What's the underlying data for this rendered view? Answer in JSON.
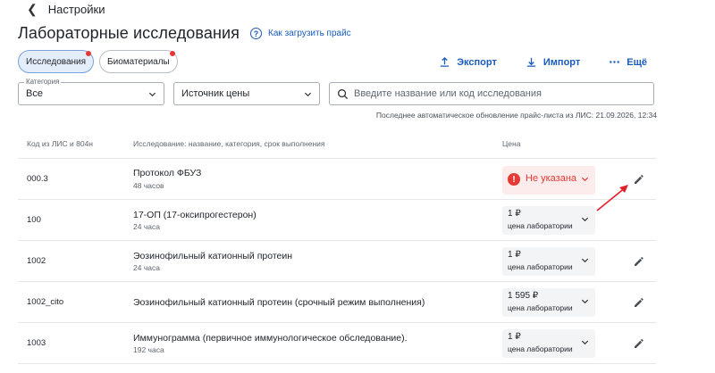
{
  "topbar": {
    "back_icon": "chevron-left-icon",
    "title": "Настройки"
  },
  "header": {
    "title": "Лабораторные исследования",
    "help_label": "Как загрузить прайс",
    "help_icon": "question-circle-icon"
  },
  "tabs": [
    {
      "label": "Исследования",
      "active": true,
      "has_dot": true
    },
    {
      "label": "Биоматериалы",
      "active": false,
      "has_dot": true
    }
  ],
  "actions": [
    {
      "label": "Экспорт",
      "icon": "upload-icon"
    },
    {
      "label": "Импорт",
      "icon": "download-icon"
    },
    {
      "label": "Ещё",
      "icon": "more-dots-icon"
    }
  ],
  "filters": {
    "category_label": "Категория",
    "category_value": "Все",
    "price_source_placeholder": "Источник цены",
    "search_placeholder": "Введите название или код исследования"
  },
  "last_update": "Последнее автоматическое обновление прайс-листа из ЛИС: 21.09.2026, 12:34",
  "table": {
    "columns": [
      "Код из ЛИС и 804н",
      "Исследование: название, категория, срок выполнения",
      "Цена"
    ],
    "rows": [
      {
        "code": "000.3",
        "name": "Протокол ФБУЗ",
        "duration": "48 часов",
        "price": "Не указана",
        "price_label": "",
        "warning": true
      },
      {
        "code": "100",
        "name": "17-ОП (17-оксипрогестерон)",
        "duration": "24 часа",
        "price": "1 ₽",
        "price_label": "цена лаборатории",
        "warning": false
      },
      {
        "code": "1002",
        "name": "Эозинофильный катионный протеин",
        "duration": "24 часа",
        "price": "1 ₽",
        "price_label": "цена лаборатории",
        "warning": false
      },
      {
        "code": "1002_cito",
        "name": "Эозинофильный катионный протеин (срочный режим выполнения)",
        "duration": "",
        "price": "1 595 ₽",
        "price_label": "цена лаборатории",
        "warning": false
      },
      {
        "code": "1003",
        "name": "Иммунограмма (первичное иммунологическое обследование).",
        "duration": "192 часа",
        "price": "1 ₽",
        "price_label": "цена лаборатории",
        "warning": false
      }
    ]
  },
  "colors": {
    "accent": "#1a5bbf",
    "warning": "#e53935",
    "annotation_arrow": "#e0202a"
  }
}
